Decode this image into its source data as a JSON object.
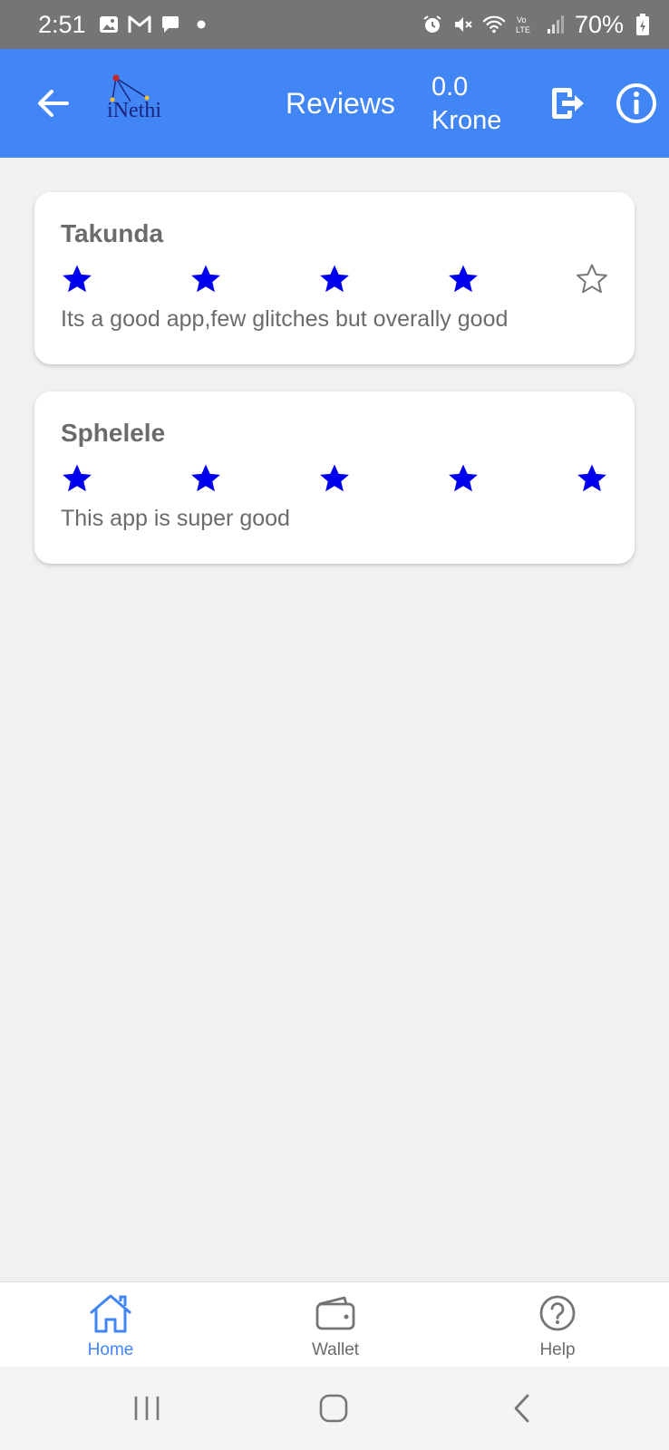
{
  "status_bar": {
    "time": "2:51",
    "battery": "70%",
    "icons_left": [
      "gallery-icon",
      "gmail-icon",
      "chat-icon",
      "dot-icon"
    ],
    "icons_right": [
      "alarm-icon",
      "mute-icon",
      "wifi-icon",
      "volte-icon",
      "signal-icon",
      "battery-icon"
    ]
  },
  "app_bar": {
    "logo_text": "iNethi",
    "title": "Reviews",
    "balance_value": "0.0",
    "balance_currency": "Krone"
  },
  "reviews": [
    {
      "name": "Takunda",
      "rating": 4,
      "max_rating": 5,
      "text": "Its a good app,few glitches but overally good"
    },
    {
      "name": "Sphelele",
      "rating": 5,
      "max_rating": 5,
      "text": "This app is super good"
    }
  ],
  "bottom_nav": {
    "items": [
      {
        "label": "Home",
        "icon": "home-icon",
        "active": true
      },
      {
        "label": "Wallet",
        "icon": "wallet-icon",
        "active": false
      },
      {
        "label": "Help",
        "icon": "help-icon",
        "active": false
      }
    ]
  },
  "colors": {
    "primary": "#4285f4",
    "star_filled": "#0000ee",
    "star_empty": "#757575",
    "text_gray": "#6b6b6b",
    "background": "#f1f1f2"
  }
}
